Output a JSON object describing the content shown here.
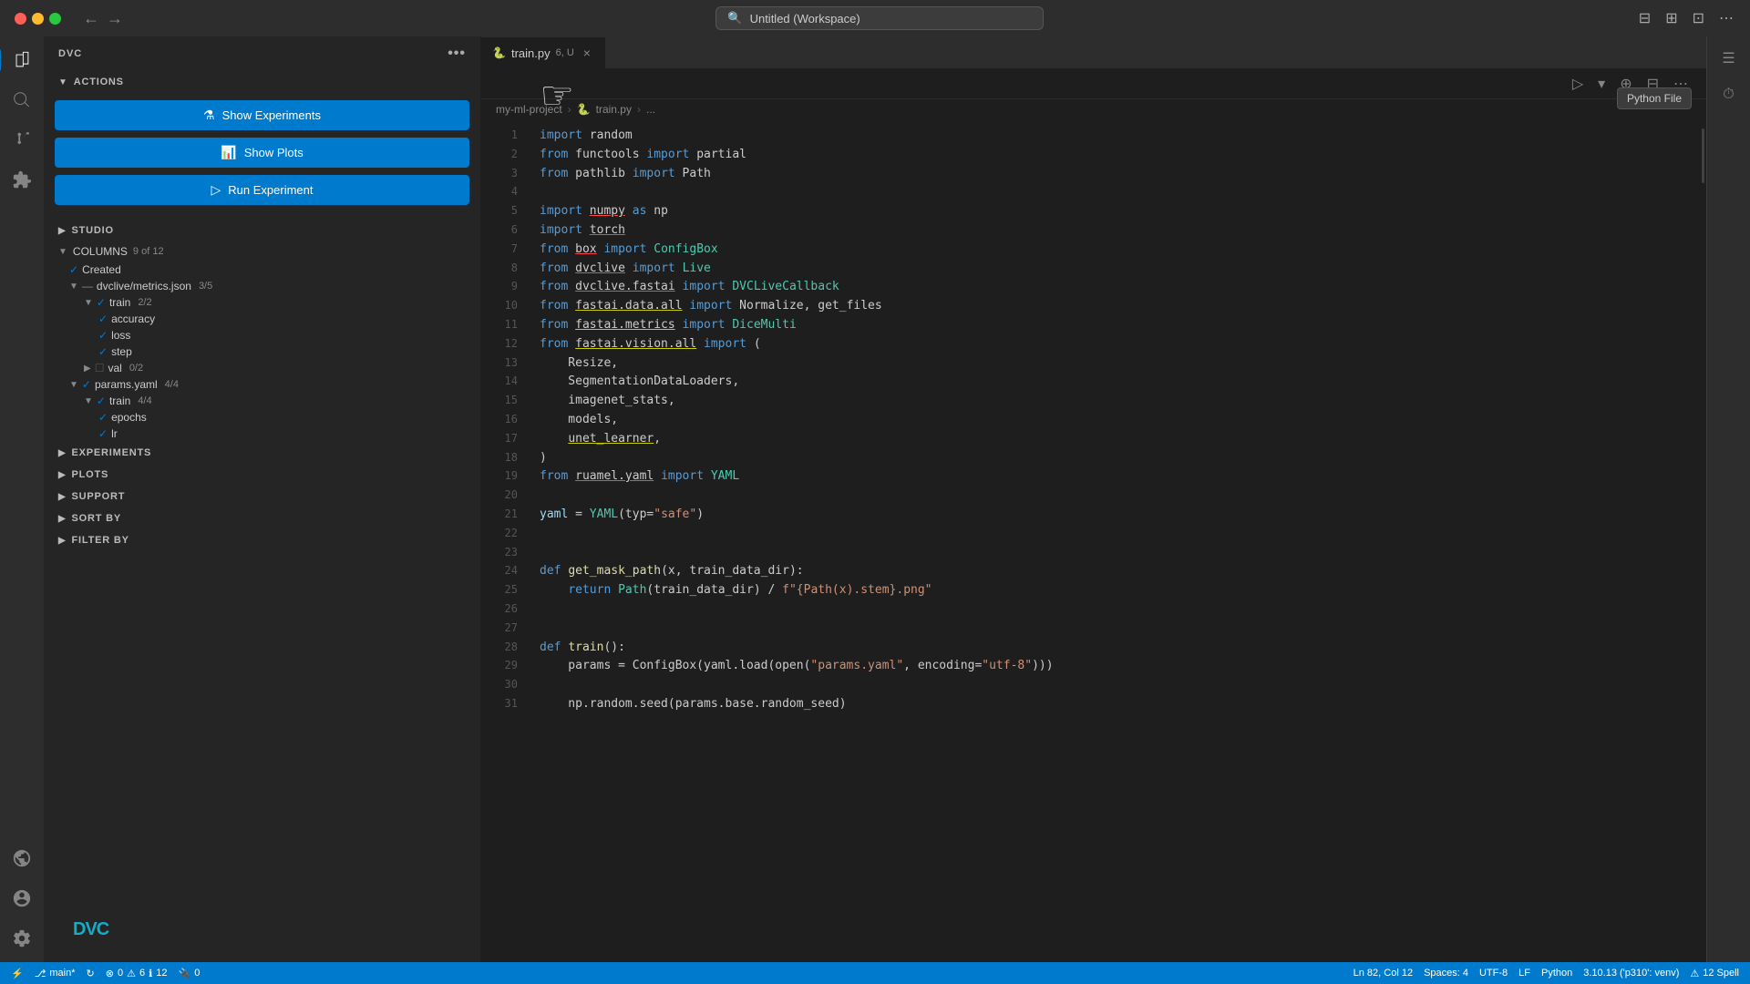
{
  "titlebar": {
    "title": "Untitled (Workspace)",
    "nav_back": "←",
    "nav_forward": "→"
  },
  "sidebar": {
    "title": "DVC",
    "more_icon": "•••",
    "actions": {
      "label": "ACTIONS",
      "show_experiments_btn": "Show Experiments",
      "show_plots_btn": "Show Plots",
      "run_experiment_btn": "Run Experiment"
    },
    "studio": {
      "label": "STUDIO"
    },
    "columns": {
      "label": "COLUMNS",
      "count": "9 of 12",
      "items": [
        {
          "label": "Created",
          "level": 1,
          "checked": true,
          "expanded": false
        },
        {
          "label": "dvclive/metrics.json",
          "level": 1,
          "checked": "partial",
          "expanded": true,
          "badge": "3/5"
        },
        {
          "label": "train",
          "level": 2,
          "checked": true,
          "expanded": true,
          "badge": "2/2"
        },
        {
          "label": "accuracy",
          "level": 3,
          "checked": true
        },
        {
          "label": "loss",
          "level": 3,
          "checked": true
        },
        {
          "label": "step",
          "level": 3,
          "checked": true
        },
        {
          "label": "val",
          "level": 2,
          "checked": false,
          "expanded": false,
          "badge": "0/2"
        },
        {
          "label": "params.yaml",
          "level": 1,
          "checked": true,
          "expanded": true,
          "badge": "4/4"
        },
        {
          "label": "train",
          "level": 2,
          "checked": true,
          "expanded": true,
          "badge": "4/4"
        },
        {
          "label": "epochs",
          "level": 3,
          "checked": true
        },
        {
          "label": "lr",
          "level": 3,
          "checked": true
        }
      ]
    },
    "experiments": {
      "label": "EXPERIMENTS"
    },
    "plots": {
      "label": "PLOTS"
    },
    "support": {
      "label": "SUPPORT"
    },
    "sort_by": {
      "label": "SORT BY"
    },
    "filter_by": {
      "label": "FILTER BY"
    },
    "dvc_logo": "DVC"
  },
  "editor": {
    "tab": {
      "filename": "train.py",
      "badge": "6, U",
      "close": "×"
    },
    "breadcrumb": {
      "project": "my-ml-project",
      "file": "train.py",
      "more": "..."
    },
    "toolbar": {
      "run_icon": "▷",
      "more_icon": "⋯"
    },
    "lines": [
      {
        "num": "1",
        "content": [
          {
            "text": "import ",
            "cls": "kw"
          },
          {
            "text": "random",
            "cls": ""
          }
        ]
      },
      {
        "num": "2",
        "content": [
          {
            "text": "from ",
            "cls": "kw"
          },
          {
            "text": "functools ",
            "cls": ""
          },
          {
            "text": "import ",
            "cls": "kw"
          },
          {
            "text": "partial",
            "cls": ""
          }
        ]
      },
      {
        "num": "3",
        "content": [
          {
            "text": "from ",
            "cls": "kw"
          },
          {
            "text": "pathlib ",
            "cls": ""
          },
          {
            "text": "import ",
            "cls": "kw"
          },
          {
            "text": "Path",
            "cls": ""
          }
        ]
      },
      {
        "num": "4",
        "content": []
      },
      {
        "num": "5",
        "content": [
          {
            "text": "import ",
            "cls": "kw"
          },
          {
            "text": "numpy",
            "cls": "underline"
          },
          {
            "text": " as ",
            "cls": "kw"
          },
          {
            "text": "np",
            "cls": ""
          }
        ]
      },
      {
        "num": "6",
        "content": [
          {
            "text": "import ",
            "cls": "kw"
          },
          {
            "text": "torch",
            "cls": "underline"
          }
        ]
      },
      {
        "num": "7",
        "content": [
          {
            "text": "from ",
            "cls": "kw"
          },
          {
            "text": "box",
            "cls": "underline"
          },
          {
            "text": " import ",
            "cls": "kw"
          },
          {
            "text": "ConfigBox",
            "cls": "cls"
          }
        ]
      },
      {
        "num": "8",
        "content": [
          {
            "text": "from ",
            "cls": "kw"
          },
          {
            "text": "dvclive",
            "cls": "underline"
          },
          {
            "text": " import ",
            "cls": "kw"
          },
          {
            "text": "Live",
            "cls": "cls"
          }
        ]
      },
      {
        "num": "9",
        "content": [
          {
            "text": "from ",
            "cls": "kw"
          },
          {
            "text": "dvclive.fastai",
            "cls": "underline"
          },
          {
            "text": " import ",
            "cls": "kw"
          },
          {
            "text": "DVCLiveCallback",
            "cls": "cls"
          }
        ]
      },
      {
        "num": "10",
        "content": [
          {
            "text": "from ",
            "cls": "kw"
          },
          {
            "text": "fastai.data.all",
            "cls": "underline-yellow"
          },
          {
            "text": " import ",
            "cls": "kw"
          },
          {
            "text": "Normalize, get_files",
            "cls": ""
          }
        ]
      },
      {
        "num": "11",
        "content": [
          {
            "text": "from ",
            "cls": "kw"
          },
          {
            "text": "fastai.metrics",
            "cls": "underline-yellow"
          },
          {
            "text": " import ",
            "cls": "kw"
          },
          {
            "text": "DiceMulti",
            "cls": "cls"
          }
        ]
      },
      {
        "num": "12",
        "content": [
          {
            "text": "from ",
            "cls": "kw"
          },
          {
            "text": "fastai.vision.all",
            "cls": "underline-yellow"
          },
          {
            "text": " import ",
            "cls": "kw"
          },
          {
            "text": "(",
            "cls": ""
          }
        ]
      },
      {
        "num": "13",
        "content": [
          {
            "text": "    Resize,",
            "cls": ""
          }
        ]
      },
      {
        "num": "14",
        "content": [
          {
            "text": "    SegmentationDataLoaders,",
            "cls": ""
          }
        ]
      },
      {
        "num": "15",
        "content": [
          {
            "text": "    imagenet_stats,",
            "cls": ""
          }
        ]
      },
      {
        "num": "16",
        "content": [
          {
            "text": "    models,",
            "cls": ""
          }
        ]
      },
      {
        "num": "17",
        "content": [
          {
            "text": "    unet_learner,",
            "cls": "underline-yellow"
          }
        ]
      },
      {
        "num": "18",
        "content": [
          {
            "text": ")",
            "cls": ""
          }
        ]
      },
      {
        "num": "19",
        "content": [
          {
            "text": "from ",
            "cls": "kw"
          },
          {
            "text": "ruamel.yaml",
            "cls": "underline"
          },
          {
            "text": " import ",
            "cls": "kw"
          },
          {
            "text": "YAML",
            "cls": "cls"
          }
        ]
      },
      {
        "num": "20",
        "content": []
      },
      {
        "num": "21",
        "content": [
          {
            "text": "yaml",
            "cls": "var"
          },
          {
            "text": " = ",
            "cls": ""
          },
          {
            "text": "YAML",
            "cls": "cls"
          },
          {
            "text": "(typ=",
            "cls": ""
          },
          {
            "text": "\"safe\"",
            "cls": "str"
          },
          {
            "text": ")",
            "cls": ""
          }
        ]
      },
      {
        "num": "22",
        "content": []
      },
      {
        "num": "23",
        "content": []
      },
      {
        "num": "24",
        "content": [
          {
            "text": "def ",
            "cls": "kw"
          },
          {
            "text": "get_mask_path",
            "cls": "fn"
          },
          {
            "text": "(x, train_data_dir):",
            "cls": ""
          }
        ]
      },
      {
        "num": "25",
        "content": [
          {
            "text": "    ",
            "cls": ""
          },
          {
            "text": "return ",
            "cls": "kw"
          },
          {
            "text": "Path",
            "cls": "cls"
          },
          {
            "text": "(train_data_dir) / ",
            "cls": ""
          },
          {
            "text": "f\"{Path(x).stem}.png\"",
            "cls": "str"
          }
        ]
      },
      {
        "num": "26",
        "content": []
      },
      {
        "num": "27",
        "content": []
      },
      {
        "num": "28",
        "content": [
          {
            "text": "def ",
            "cls": "kw"
          },
          {
            "text": "train",
            "cls": "fn"
          },
          {
            "text": "():",
            "cls": ""
          }
        ]
      },
      {
        "num": "29",
        "content": [
          {
            "text": "    params = ConfigBox(yaml.load(open(",
            "cls": ""
          },
          {
            "text": "\"params.yaml\"",
            "cls": "str"
          },
          {
            "text": ", encoding=",
            "cls": ""
          },
          {
            "text": "\"utf-8\"",
            "cls": "str"
          },
          {
            "text": ")))",
            "cls": ""
          }
        ]
      },
      {
        "num": "30",
        "content": []
      },
      {
        "num": "31",
        "content": [
          {
            "text": "    np.random.seed(params.base.random_seed)",
            "cls": ""
          }
        ]
      }
    ]
  },
  "status_bar": {
    "git_branch": "main*",
    "sync_icon": "↻",
    "error_count": "0",
    "warning_count": "6",
    "info_count": "12",
    "port": "0",
    "position": "Ln 82, Col 12",
    "spaces": "Spaces: 4",
    "encoding": "UTF-8",
    "line_ending": "LF",
    "language": "Python",
    "version": "3.10.13 ('p310': venv)",
    "spell_count": "12 Spell"
  },
  "python_badge": "Python File"
}
